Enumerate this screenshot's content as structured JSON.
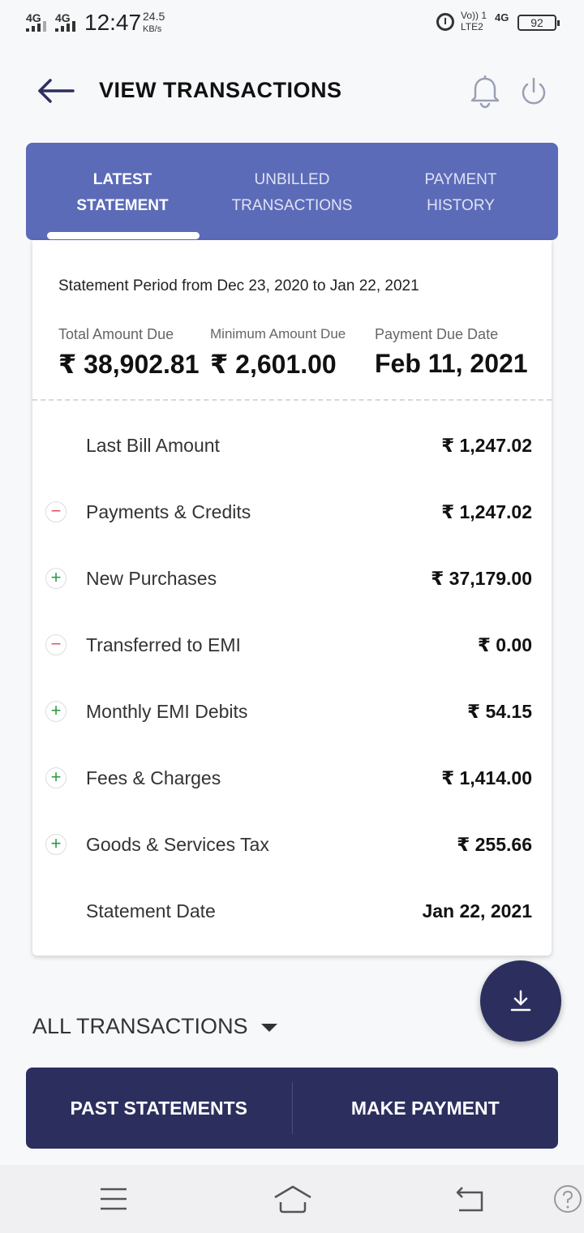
{
  "status_bar": {
    "sim1": "4G",
    "sim2": "4G",
    "time": "12:47",
    "speed_value": "24.5",
    "speed_unit": "KB/s",
    "volte_line1": "Vo)) 1",
    "volte_line2": "LTE2",
    "net": "4G",
    "battery": "92"
  },
  "header": {
    "title": "VIEW TRANSACTIONS",
    "back_icon": "back-arrow-icon",
    "bell_icon": "bell-icon",
    "power_icon": "power-icon"
  },
  "tabs": [
    {
      "line1": "LATEST",
      "line2": "STATEMENT",
      "active": true
    },
    {
      "line1": "UNBILLED",
      "line2": "TRANSACTIONS",
      "active": false
    },
    {
      "line1": "PAYMENT",
      "line2": "HISTORY",
      "active": false
    }
  ],
  "statement": {
    "period": "Statement Period from Dec 23, 2020 to Jan 22, 2021",
    "total_due_label": "Total Amount Due",
    "total_due_value": "₹ 38,902.81",
    "min_due_label": "Minimum Amount Due",
    "min_due_value": "₹ 2,601.00",
    "due_date_label": "Payment Due Date",
    "due_date_value": "Feb 11, 2021",
    "rows": [
      {
        "sign": "",
        "label": "Last Bill Amount",
        "amount": "₹ 1,247.02"
      },
      {
        "sign": "−",
        "label": "Payments & Credits",
        "amount": "₹ 1,247.02"
      },
      {
        "sign": "+",
        "label": "New Purchases",
        "amount": "₹ 37,179.00"
      },
      {
        "sign": "−",
        "label": "Transferred to EMI",
        "amount": "₹ 0.00"
      },
      {
        "sign": "+",
        "label": "Monthly EMI Debits",
        "amount": "₹ 54.15"
      },
      {
        "sign": "+",
        "label": "Fees & Charges",
        "amount": "₹ 1,414.00"
      },
      {
        "sign": "+",
        "label": "Goods & Services Tax",
        "amount": "₹ 255.66"
      },
      {
        "sign": "",
        "label": "Statement Date",
        "amount": "Jan 22, 2021"
      }
    ]
  },
  "filter": {
    "label": "ALL TRANSACTIONS"
  },
  "actions": {
    "past_statements": "PAST STATEMENTS",
    "make_payment": "MAKE PAYMENT"
  },
  "colors": {
    "tab_bg": "#5c6bb8",
    "primary_dark": "#2c2f5e",
    "minus": "#e05262",
    "plus": "#2d9b47"
  }
}
